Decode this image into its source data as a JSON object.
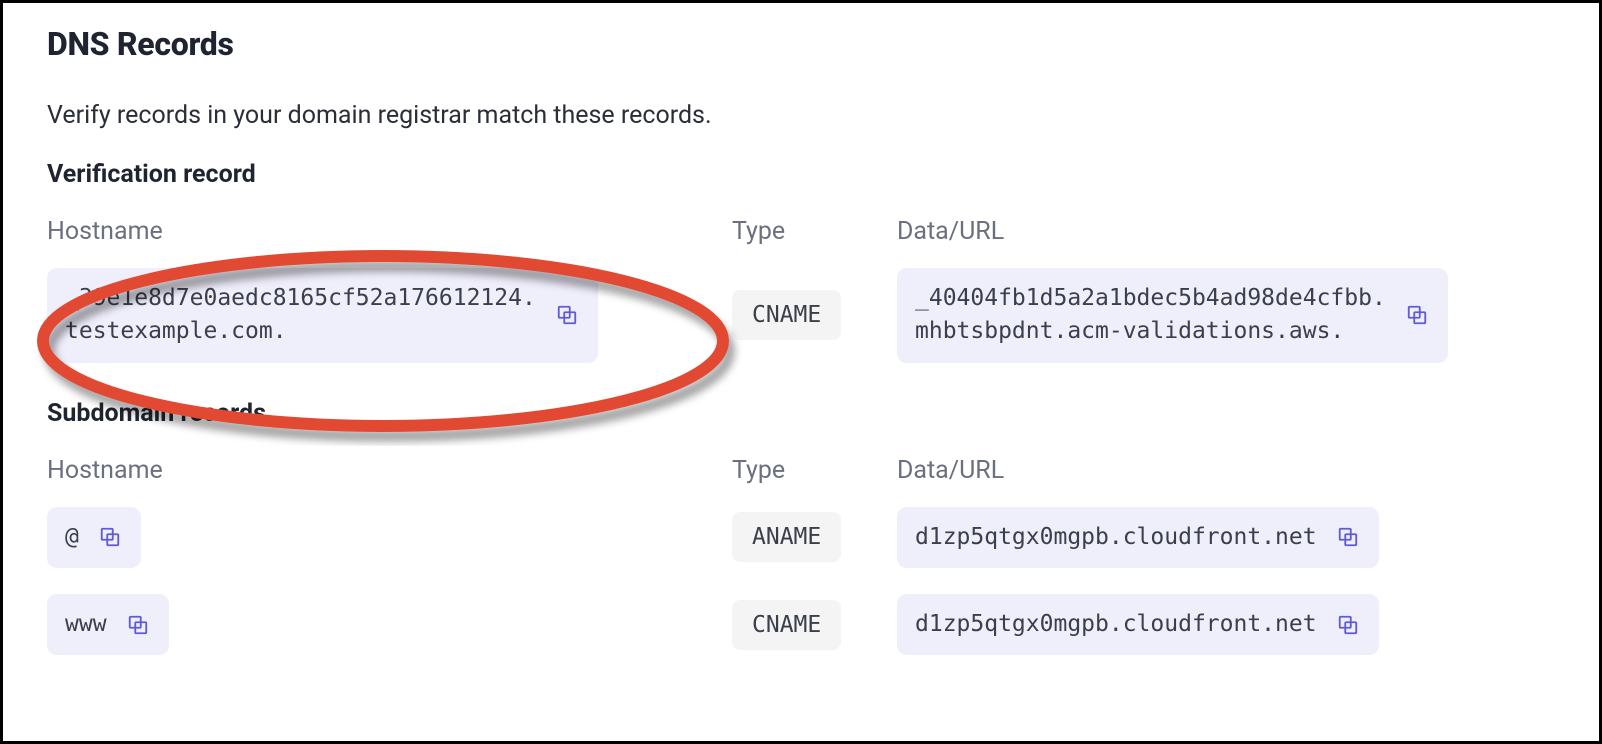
{
  "title": "DNS Records",
  "subtitle": "Verify records in your domain registrar match these records.",
  "sections": {
    "verification": {
      "heading": "Verification record",
      "columns": {
        "host": "Hostname",
        "type": "Type",
        "data": "Data/URL"
      },
      "row": {
        "hostname": "_39e1e8d7e0aedc8165cf52a176612124.\ntestexample.com.",
        "type": "CNAME",
        "data": "_40404fb1d5a2a1bdec5b4ad98de4cfbb.\nmhbtsbpdnt.acm-validations.aws."
      }
    },
    "subdomain": {
      "heading": "Subdomain records",
      "columns": {
        "host": "Hostname",
        "type": "Type",
        "data": "Data/URL"
      },
      "rows": [
        {
          "hostname": "@",
          "type": "ANAME",
          "data": "d1zp5qtgx0mgpb.cloudfront.net"
        },
        {
          "hostname": "www",
          "type": "CNAME",
          "data": "d1zp5qtgx0mgpb.cloudfront.net"
        }
      ]
    }
  }
}
